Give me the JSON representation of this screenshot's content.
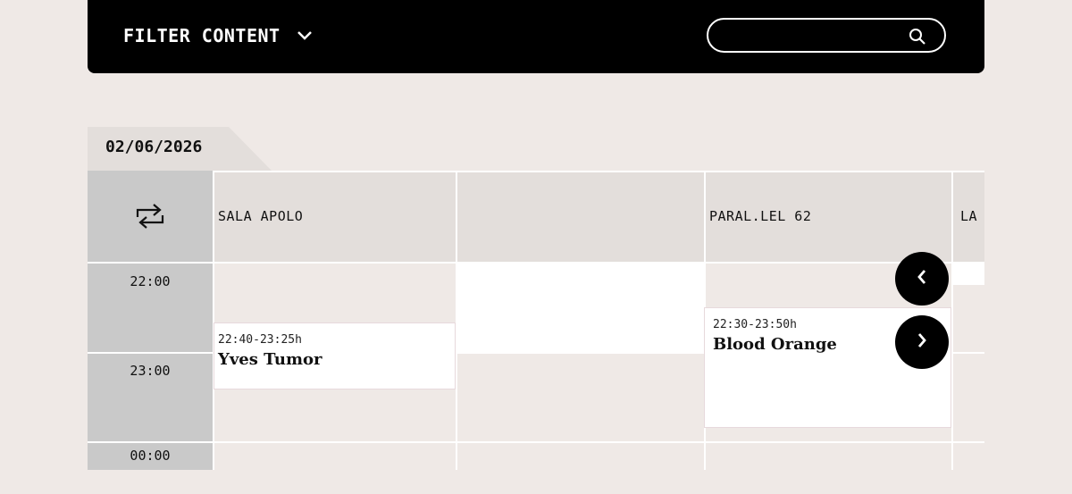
{
  "filter": {
    "label": "FILTER CONTENT",
    "chevron_icon": "chevron-down-icon"
  },
  "search": {
    "value": "",
    "placeholder": "",
    "icon": "search-icon"
  },
  "date": "02/06/2026",
  "venues": [
    "SALA APOLO",
    "",
    "PARAL.LEL 62",
    "LA"
  ],
  "times": [
    "22:00",
    "23:00",
    "00:00"
  ],
  "events": [
    {
      "venue": "SALA APOLO",
      "time": "22:40-23:25h",
      "title": "Yves Tumor"
    },
    {
      "venue": "PARAL.LEL 62",
      "time": "22:30-23:50h",
      "title": "Blood Orange"
    }
  ],
  "icons": {
    "swap": "swap-arrows-icon",
    "prev": "chevron-left-icon",
    "next": "chevron-right-icon"
  },
  "colors": {
    "topbar": "#000000",
    "background": "#efe9e6",
    "header": "#e3dedb",
    "time_column": "#c9c9c9"
  }
}
